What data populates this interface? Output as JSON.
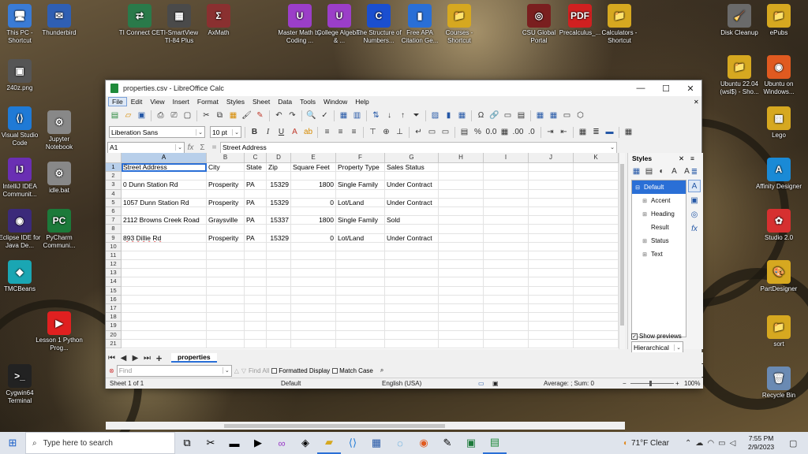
{
  "desktop": {
    "icons_left": [
      {
        "label": "This PC - Shortcut",
        "glyph": "🖥",
        "color": "#3a7bd5"
      },
      {
        "label": "Thunderbird",
        "glyph": "✉",
        "color": "#2f5fb3"
      },
      {
        "label": "240z.png",
        "glyph": "▣",
        "color": "#555"
      },
      {
        "label": "Visual Studio Code",
        "glyph": "⟨⟩",
        "color": "#1f7ad6"
      },
      {
        "label": "Jupyter Notebook",
        "glyph": "⚙",
        "color": "#888"
      },
      {
        "label": "IntelliJ IDEA Communit...",
        "glyph": "IJ",
        "color": "#6a2fb3"
      },
      {
        "label": "idle.bat",
        "glyph": "⚙",
        "color": "#888"
      },
      {
        "label": "Eclipse IDE for Java De...",
        "glyph": "◉",
        "color": "#3b2a7a"
      },
      {
        "label": "PyCharm Communi...",
        "glyph": "PC",
        "color": "#1c7a3a"
      },
      {
        "label": "TMCBeans",
        "glyph": "◆",
        "color": "#1aa6b3"
      },
      {
        "label": "Lesson 1 Python Prog...",
        "glyph": "▶",
        "color": "#e02020"
      },
      {
        "label": "Cygwin64 Terminal",
        "glyph": ">_",
        "color": "#222"
      }
    ],
    "icons_top": [
      {
        "label": "TI Connect CE",
        "glyph": "⇄",
        "color": "#2a7a4a"
      },
      {
        "label": "TI-SmartView TI-84 Plus",
        "glyph": "▦",
        "color": "#4a4a4a"
      },
      {
        "label": "AxMath",
        "glyph": "Σ",
        "color": "#8a3030"
      },
      {
        "label": "Master Math by Coding ...",
        "glyph": "U",
        "color": "#9b3ec8"
      },
      {
        "label": "College Algebra & ...",
        "glyph": "U",
        "color": "#9b3ec8"
      },
      {
        "label": "The Structure of Numbers...",
        "glyph": "C",
        "color": "#1a4fd0"
      },
      {
        "label": "Free APA Citation Ge...",
        "glyph": "▮",
        "color": "#2a6fd6"
      },
      {
        "label": "Courses - Shortcut",
        "glyph": "📁",
        "color": "#d6a820"
      },
      {
        "label": "CSU Global Portal",
        "glyph": "◎",
        "color": "#7a1f1f"
      },
      {
        "label": "Precalculus_...",
        "glyph": "PDF",
        "color": "#d02020"
      },
      {
        "label": "Calculators - Shortcut",
        "glyph": "📁",
        "color": "#d6a820"
      }
    ],
    "icons_right": [
      {
        "label": "Disk Cleanup",
        "glyph": "🧹",
        "color": "#6a6a6a"
      },
      {
        "label": "ePubs",
        "glyph": "📁",
        "color": "#d6a820"
      },
      {
        "label": "Ubuntu 22.04 (wsl$) - Sho...",
        "glyph": "📁",
        "color": "#d6a820"
      },
      {
        "label": "Ubuntu on Windows...",
        "glyph": "◉",
        "color": "#e05a20"
      },
      {
        "label": "Lego",
        "glyph": "▩",
        "color": "#d6a820"
      },
      {
        "label": "Affinity Designer",
        "glyph": "A",
        "color": "#1a8ad6"
      },
      {
        "label": "Studio 2.0",
        "glyph": "✿",
        "color": "#d63030"
      },
      {
        "label": "PartDesigner",
        "glyph": "🎨",
        "color": "#d6a820"
      },
      {
        "label": "sort",
        "glyph": "📁",
        "color": "#d6a820"
      },
      {
        "label": "Recycle Bin",
        "glyph": "🗑",
        "color": "#6a8ab3"
      }
    ]
  },
  "window": {
    "title": "properties.csv - LibreOffice Calc",
    "menu": [
      "File",
      "Edit",
      "View",
      "Insert",
      "Format",
      "Styles",
      "Sheet",
      "Data",
      "Tools",
      "Window",
      "Help"
    ],
    "font_name": "Liberation Sans",
    "font_size": "10 pt",
    "cell_ref": "A1",
    "formula": "Street Address"
  },
  "sheet": {
    "columns": [
      "A",
      "B",
      "C",
      "D",
      "E",
      "F",
      "G",
      "H",
      "I",
      "J",
      "K"
    ],
    "rows": [
      [
        "Street Address",
        "City",
        "State",
        "Zip",
        "Square Feet",
        "Property Type",
        "Sales Status"
      ],
      [],
      [
        "0 Dunn Station Rd",
        "Prosperity",
        "PA",
        "15329",
        "1800",
        "Single Family",
        "Under Contract"
      ],
      [],
      [
        "1057 Dunn Station Rd",
        "Prosperity",
        "PA",
        "15329",
        "0",
        "Lot/Land",
        "Under Contract"
      ],
      [],
      [
        "2112 Browns Creek Road",
        "Graysville",
        "PA",
        "15337",
        "1800",
        "Single Family",
        "Sold"
      ],
      [],
      [
        "893 Dillie Rd",
        "Prosperity",
        "PA",
        "15329",
        "0",
        "Lot/Land",
        "Under Contract"
      ],
      [],
      [],
      [],
      [],
      [],
      [],
      [],
      [],
      [],
      [],
      [],
      []
    ],
    "tab_name": "properties"
  },
  "sidebar": {
    "title": "Styles",
    "items": [
      "Default",
      "Accent",
      "Heading",
      "Result",
      "Status",
      "Text"
    ],
    "show_previews": "Show previews",
    "mode": "Hierarchical"
  },
  "findbar": {
    "placeholder": "Find",
    "find_all": "Find All",
    "formatted_display": "Formatted Display",
    "match_case": "Match Case"
  },
  "status": {
    "sheet": "Sheet 1 of 1",
    "style": "Default",
    "language": "English (USA)",
    "summary": "Average: ; Sum: 0",
    "zoom": "100%"
  },
  "taskbar": {
    "search_placeholder": "Type here to search",
    "weather": "71°F  Clear",
    "time": "7:55 PM",
    "date": "2/9/2023"
  }
}
